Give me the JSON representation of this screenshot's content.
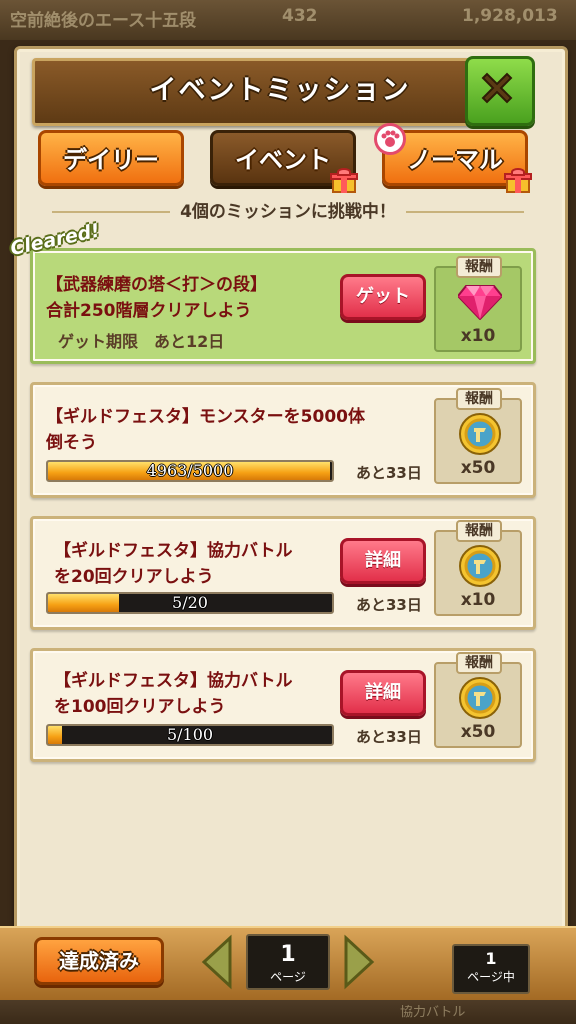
{
  "background": {
    "top_text_left": "空前絶後のエース十五段",
    "top_text_mid": "432",
    "top_text_right": "1,928,013",
    "bottom_text": "協力バトル"
  },
  "header": {
    "title": "イベントミッション"
  },
  "tabs": [
    {
      "label": "デイリー"
    },
    {
      "label": "イベント"
    },
    {
      "label": "ノーマル"
    }
  ],
  "subtitle": "4個のミッションに挑戦中！",
  "missions": [
    {
      "cleared_badge": "Cleared!",
      "line1": "【武器練磨の塔＜打＞の段】",
      "line2": "合計250階層クリアしよう",
      "deadline": "ゲット期限　あと12日",
      "button": "ゲット",
      "reward_header": "報酬",
      "reward_icon": "gem-icon",
      "reward_qty": "x10"
    },
    {
      "line1": "【ギルドフェスタ】モンスターを5000体",
      "line2": "倒そう",
      "progress_text": "4963/5000",
      "progress_fraction": 0.9926,
      "days_left": "あと33日",
      "reward_header": "報酬",
      "reward_icon": "medal-icon",
      "reward_qty": "x50"
    },
    {
      "line1": "【ギルドフェスタ】協力バトル",
      "line2": "を20回クリアしよう",
      "button": "詳細",
      "progress_text": "5/20",
      "progress_fraction": 0.25,
      "days_left": "あと33日",
      "reward_header": "報酬",
      "reward_icon": "medal-icon",
      "reward_qty": "x10"
    },
    {
      "line1": "【ギルドフェスタ】協力バトル",
      "line2": "を100回クリアしよう",
      "button": "詳細",
      "progress_text": "5/100",
      "progress_fraction": 0.05,
      "days_left": "あと33日",
      "reward_header": "報酬",
      "reward_icon": "medal-icon",
      "reward_qty": "x50"
    }
  ],
  "footer": {
    "achieved_button": "達成済み",
    "page_number": "1",
    "page_label": "ページ",
    "current_page_number": "1",
    "current_page_label": "ページ中"
  },
  "colors": {
    "orange_tab": "#f07010",
    "brown_tab": "#5a3410",
    "close_green": "#4aa11f",
    "cleared_green": "#b8d97a",
    "mission_text": "#7a1010",
    "red_button": "#e2304a"
  }
}
